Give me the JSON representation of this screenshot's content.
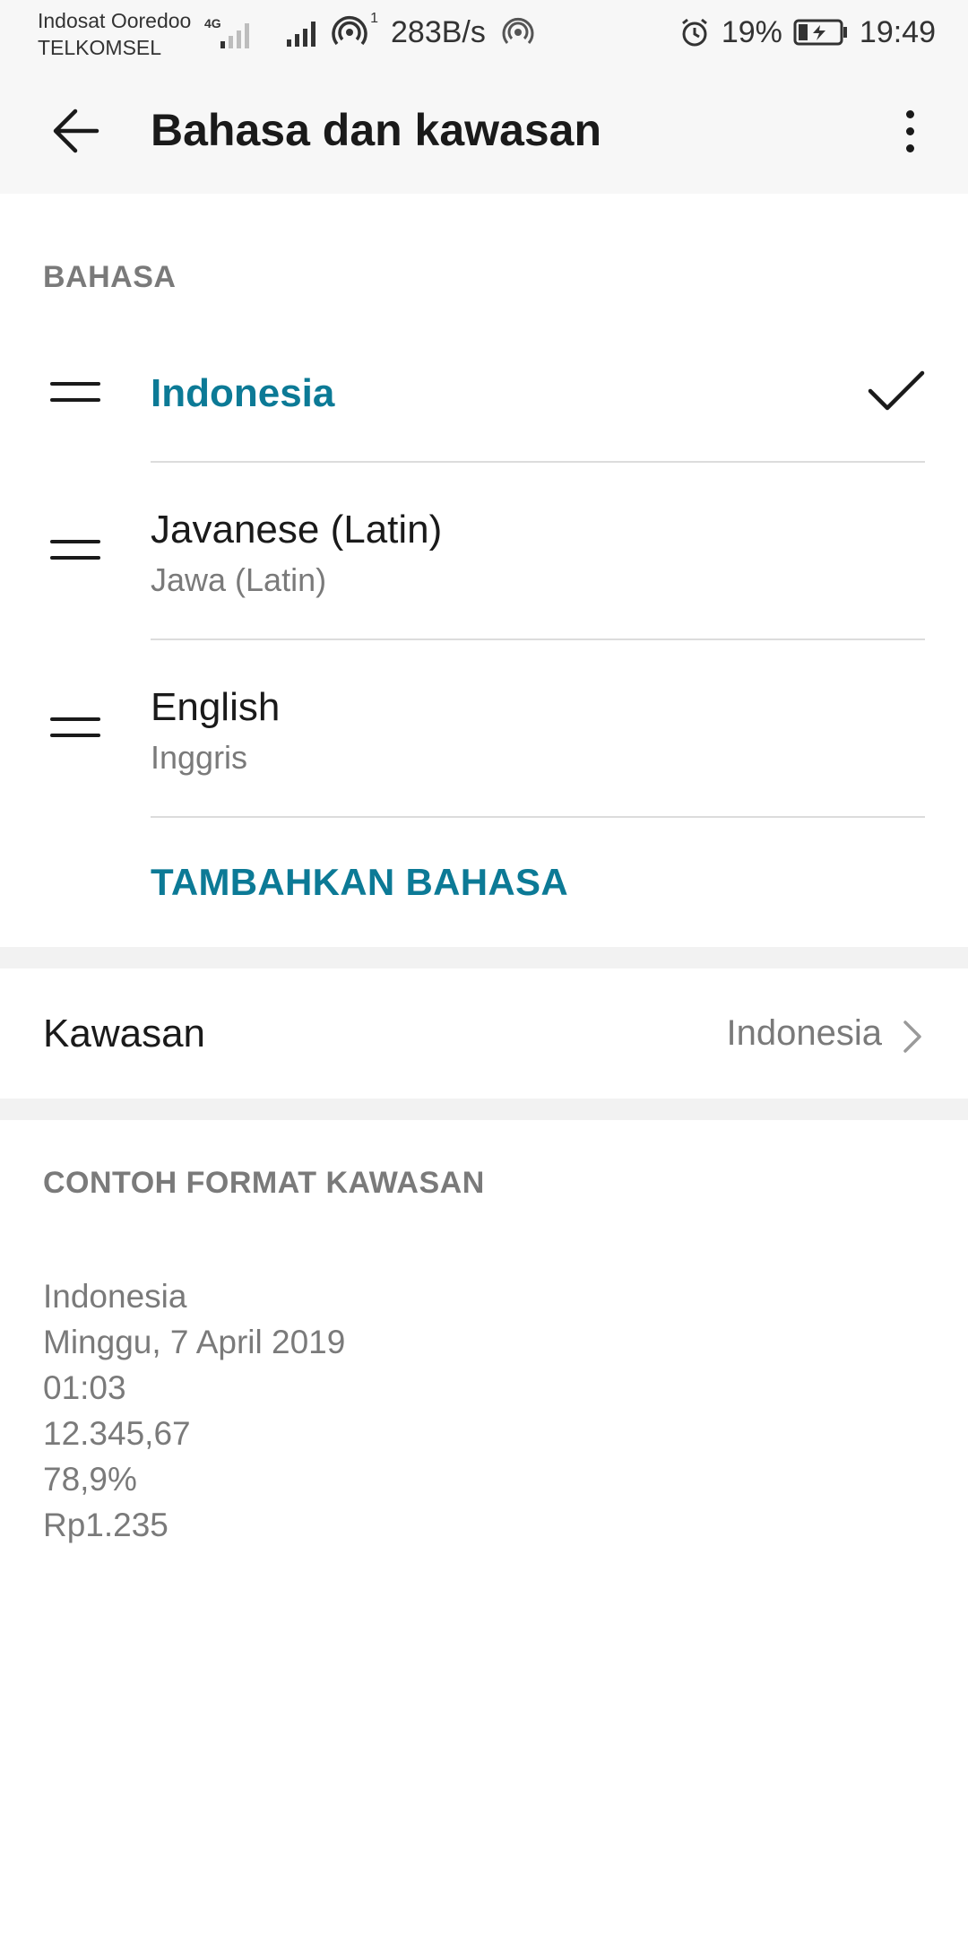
{
  "status_bar": {
    "carrier_1": "Indosat Ooredoo",
    "carrier_2": "TELKOMSEL",
    "network_type": "4G",
    "hotspot_count": "1",
    "net_speed": "283B/s",
    "battery_percent": "19%",
    "time": "19:49",
    "icons": [
      "signal-4g-icon",
      "signal-icon",
      "hotspot-icon",
      "nfc-icon",
      "alarm-icon",
      "battery-charging-icon"
    ]
  },
  "app_bar": {
    "title": "Bahasa dan kawasan",
    "back_icon": "arrow-left-icon",
    "menu_icon": "more-vertical-icon"
  },
  "language_section": {
    "header": "BAHASA",
    "items": [
      {
        "name": "Indonesia",
        "subtitle": "",
        "selected": true
      },
      {
        "name": "Javanese (Latin)",
        "subtitle": "Jawa (Latin)",
        "selected": false
      },
      {
        "name": "English",
        "subtitle": "Inggris",
        "selected": false
      }
    ],
    "add_button": "TAMBAHKAN BAHASA"
  },
  "region": {
    "label": "Kawasan",
    "value": "Indonesia"
  },
  "format_example": {
    "header": "CONTOH FORMAT KAWASAN",
    "lines": [
      "Indonesia",
      "Minggu, 7 April 2019",
      "01:03",
      "12.345,67",
      "78,9%",
      "Rp1.235"
    ]
  },
  "colors": {
    "accent": "#0c7a96",
    "secondary_text": "#7a7a7a",
    "bar_background": "#f7f7f7"
  }
}
